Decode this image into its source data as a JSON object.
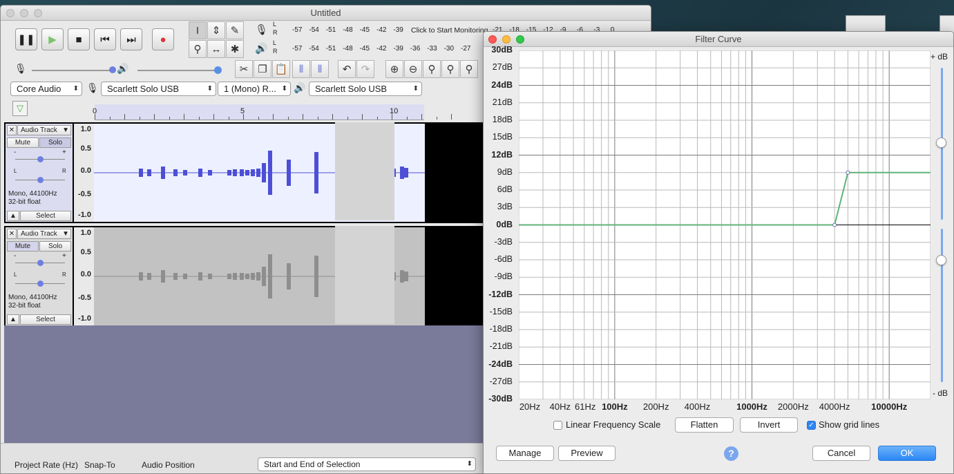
{
  "main_window": {
    "title": "Untitled",
    "meters": {
      "record_ticks": [
        "-57",
        "-54",
        "-51",
        "-48",
        "-45",
        "-42",
        "-39"
      ],
      "monitor_label": "Click to Start Monitoring",
      "record_ticks_right": [
        "-21",
        "-18",
        "-15",
        "-12",
        "-9",
        "-6",
        "-3",
        "0"
      ],
      "playback_ticks": [
        "-57",
        "-54",
        "-51",
        "-48",
        "-45",
        "-42",
        "-39",
        "-36",
        "-33",
        "-30",
        "-27"
      ],
      "lr": [
        "L",
        "R"
      ]
    },
    "devices": {
      "host": "Core Audio",
      "recording_device": "Scarlett Solo USB",
      "channels": "1 (Mono) R...",
      "playback_device": "Scarlett Solo USB"
    },
    "ruler_ticks": [
      "0",
      "5",
      "10"
    ],
    "tracks": [
      {
        "name": "Audio Track",
        "mute": "Mute",
        "solo": "Solo",
        "info1": "Mono, 44100Hz",
        "info2": "32-bit float",
        "select": "Select",
        "scale": [
          "1.0",
          "0.5",
          "0.0",
          "-0.5",
          "-1.0"
        ],
        "gain_marks": [
          "-",
          "+"
        ],
        "pan_marks": [
          "L",
          "R"
        ]
      },
      {
        "name": "Audio Track",
        "mute": "Mute",
        "solo": "Solo",
        "info1": "Mono, 44100Hz",
        "info2": "32-bit float",
        "select": "Select",
        "scale": [
          "1.0",
          "0.5",
          "0.0",
          "-0.5",
          "-1.0"
        ],
        "gain_marks": [
          "-",
          "+"
        ],
        "pan_marks": [
          "L",
          "R"
        ]
      }
    ],
    "bottom": {
      "project_rate": "Project Rate (Hz)",
      "snap_to": "Snap-To",
      "audio_position": "Audio Position",
      "selection_mode": "Start and End of Selection"
    }
  },
  "filter_window": {
    "title": "Filter Curve",
    "y_labels": [
      "30dB",
      "27dB",
      "24dB",
      "21dB",
      "18dB",
      "15dB",
      "12dB",
      "9dB",
      "6dB",
      "3dB",
      "0dB",
      "-3dB",
      "-6dB",
      "-9dB",
      "-12dB",
      "-15dB",
      "-18dB",
      "-21dB",
      "-24dB",
      "-27dB",
      "-30dB"
    ],
    "bold_y": [
      "30dB",
      "24dB",
      "12dB",
      "0dB",
      "-12dB",
      "-24dB",
      "-30dB"
    ],
    "x_labels": [
      "20Hz",
      "40Hz",
      "61Hz",
      "100Hz",
      "200Hz",
      "400Hz",
      "1000Hz",
      "2000Hz",
      "4000Hz",
      "10000Hz"
    ],
    "bold_x": [
      "100Hz",
      "1000Hz",
      "10000Hz"
    ],
    "slider_top_label": "+ dB",
    "slider_bottom_label": "- dB",
    "curve_points": [
      {
        "freq": 20,
        "db": 0
      },
      {
        "freq": 4000,
        "db": 0
      },
      {
        "freq": 5000,
        "db": 9
      },
      {
        "freq": 20000,
        "db": 9
      }
    ],
    "linear_scale_label": "Linear Frequency Scale",
    "linear_scale_checked": false,
    "flatten_label": "Flatten",
    "invert_label": "Invert",
    "grid_label": "Show grid lines",
    "grid_checked": true,
    "manage_label": "Manage",
    "preview_label": "Preview",
    "help_label": "?",
    "cancel_label": "Cancel",
    "ok_label": "OK",
    "accent_color": "#2a86f5",
    "curve_color": "#5fb37a"
  }
}
